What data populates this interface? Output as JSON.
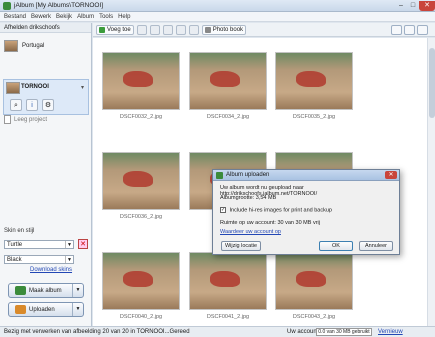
{
  "window": {
    "title": "jAlbum [My Albums\\TORNOOI]"
  },
  "menu": [
    "Bestand",
    "Bewerk",
    "Bekijk",
    "Album",
    "Tools",
    "Help"
  ],
  "left": {
    "header": "Afhelden drikschoofs",
    "albums": [
      {
        "name": "Portugal"
      },
      {
        "name": "TORNOOI"
      }
    ],
    "new_project": "Leeg project",
    "skin_label": "Skin en stijl",
    "skin": "Turtle",
    "style": "Black",
    "download_skins": "Download skins",
    "make_album": "Maak album",
    "upload": "Uploaden"
  },
  "toolbar": {
    "add": "Voeg toe",
    "photobook": "Photo book"
  },
  "photos": [
    {
      "name": "DSCF0032_2.jpg"
    },
    {
      "name": "DSCF0034_2.jpg"
    },
    {
      "name": "DSCF0035_2.jpg"
    },
    {
      "name": "DSCF0036_2.jpg"
    },
    {
      "name": ""
    },
    {
      "name": ""
    },
    {
      "name": "DSCF0040_2.jpg"
    },
    {
      "name": "DSCF0041_2.jpg"
    },
    {
      "name": "DSCF0043_2.jpg"
    }
  ],
  "dialog": {
    "title": "Album uploaden",
    "line1": "Uw album wordt nu geupload naar http://drikschoofs.jalbum.net/TORNOOI/",
    "line2": "Albumgrootte: 3,54 MB",
    "checkbox": "Include hi-res images for print and backup",
    "space": "Ruimte op uw account: 30 van 30 MB vrij",
    "upgrade": "Waardeer uw account op",
    "btn_location": "Wijzig locatie",
    "btn_ok": "OK",
    "btn_cancel": "Annuleer"
  },
  "status": {
    "text": "Bezig met verwerken van afbeelding 20 van 20 in TORNOOI...Gereed",
    "account_label": "Uw account",
    "usage": "0.0 van 30 MB gebruikt",
    "renew": "Vernieuw"
  },
  "colors": {
    "accent": "#3b8b3b",
    "selection": "#dde9f8"
  }
}
